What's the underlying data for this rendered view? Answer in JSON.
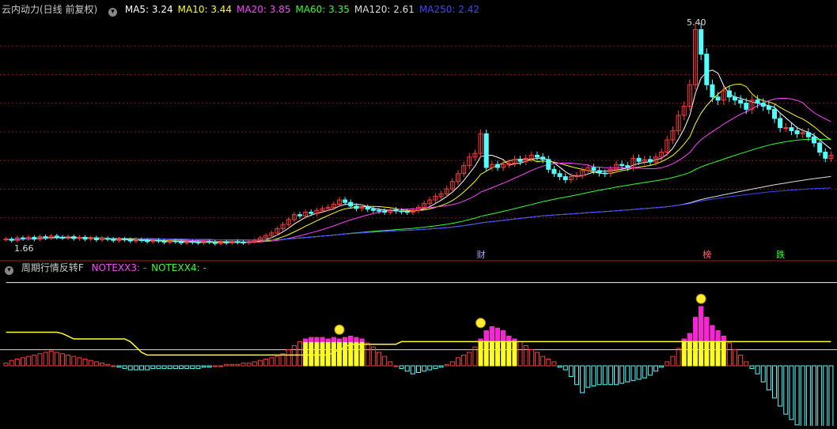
{
  "main_panel": {
    "title": "云内动力(日线 前复权)",
    "ma_labels": [
      {
        "text": "MA5: 3.24",
        "color": "#ffffff"
      },
      {
        "text": "MA10: 3.44",
        "color": "#ffff00"
      },
      {
        "text": "MA20: 3.85",
        "color": "#ff44ff"
      },
      {
        "text": "MA60: 3.35",
        "color": "#33ff33"
      },
      {
        "text": "MA120: 2.61",
        "color": "#dddddd"
      },
      {
        "text": "MA250: 2.42",
        "color": "#4444ff"
      }
    ],
    "high_label": "5.40",
    "low_label": "1.66",
    "markers": [
      {
        "text": "财",
        "color": "#aaaaff",
        "bar": 84
      },
      {
        "text": "榜",
        "color": "#ff6666",
        "bar": 124
      },
      {
        "text": "跌",
        "color": "#33ff33",
        "bar": 137
      }
    ]
  },
  "indicator_panel": {
    "title": "周期行情反转F",
    "notes": [
      {
        "text": "NOTEXX3: -",
        "color": "#ff44ff"
      },
      {
        "text": "NOTEXX4: -",
        "color": "#33ff33"
      }
    ]
  },
  "chart_data": {
    "type": "candlestick",
    "price_range": [
      1.66,
      5.4
    ],
    "closes": [
      1.78,
      1.76,
      1.8,
      1.79,
      1.81,
      1.78,
      1.82,
      1.8,
      1.83,
      1.81,
      1.8,
      1.82,
      1.79,
      1.81,
      1.78,
      1.8,
      1.77,
      1.79,
      1.78,
      1.76,
      1.78,
      1.77,
      1.75,
      1.77,
      1.76,
      1.74,
      1.76,
      1.75,
      1.73,
      1.75,
      1.74,
      1.72,
      1.74,
      1.73,
      1.72,
      1.74,
      1.73,
      1.71,
      1.73,
      1.72,
      1.74,
      1.73,
      1.72,
      1.74,
      1.76,
      1.8,
      1.84,
      1.88,
      1.95,
      2.02,
      2.1,
      2.18,
      2.16,
      2.22,
      2.2,
      2.25,
      2.28,
      2.3,
      2.35,
      2.42,
      2.38,
      2.32,
      2.28,
      2.3,
      2.27,
      2.25,
      2.24,
      2.22,
      2.26,
      2.24,
      2.23,
      2.22,
      2.25,
      2.3,
      2.36,
      2.42,
      2.48,
      2.52,
      2.6,
      2.72,
      2.85,
      2.98,
      3.12,
      3.18,
      3.5,
      2.95,
      3.0,
      2.95,
      3.0,
      3.02,
      3.08,
      3.05,
      3.1,
      3.15,
      3.12,
      3.08,
      2.92,
      2.85,
      2.8,
      2.75,
      2.8,
      2.82,
      2.9,
      2.95,
      2.9,
      2.86,
      2.85,
      2.92,
      3.0,
      2.98,
      2.95,
      3.1,
      3.05,
      3.08,
      3.04,
      3.12,
      3.2,
      3.4,
      3.55,
      3.8,
      3.95,
      4.3,
      5.2,
      4.8,
      4.3,
      4.1,
      4.05,
      4.2,
      4.1,
      4.05,
      4.0,
      3.9,
      4.05,
      4.0,
      3.95,
      3.9,
      3.75,
      3.6,
      3.6,
      3.55,
      3.5,
      3.52,
      3.45,
      3.35,
      3.2,
      3.1,
      3.15
    ],
    "indicator_range": [
      -1.0,
      1.0
    ],
    "indicator_bars": [
      0.02,
      0.04,
      0.05,
      0.06,
      0.07,
      0.08,
      0.09,
      0.1,
      0.11,
      0.1,
      0.09,
      0.08,
      0.07,
      0.06,
      0.05,
      0.04,
      0.03,
      0.02,
      0.01,
      0.0,
      -0.01,
      -0.02,
      -0.03,
      -0.03,
      -0.03,
      -0.03,
      -0.02,
      -0.02,
      -0.02,
      -0.02,
      -0.02,
      -0.02,
      -0.02,
      -0.02,
      -0.02,
      -0.01,
      -0.01,
      0.0,
      0.0,
      0.01,
      0.01,
      0.01,
      0.02,
      0.02,
      0.03,
      0.04,
      0.05,
      0.06,
      0.07,
      0.09,
      0.12,
      0.15,
      0.18,
      0.2,
      0.21,
      0.21,
      0.21,
      0.2,
      0.21,
      0.2,
      0.21,
      0.22,
      0.21,
      0.2,
      0.17,
      0.14,
      0.1,
      0.07,
      0.03,
      0.0,
      -0.02,
      -0.04,
      -0.06,
      -0.05,
      -0.04,
      -0.03,
      -0.02,
      -0.01,
      0.01,
      0.03,
      0.06,
      0.08,
      0.1,
      0.14,
      0.2,
      0.26,
      0.29,
      0.28,
      0.26,
      0.22,
      0.2,
      0.18,
      0.15,
      0.12,
      0.1,
      0.07,
      0.05,
      0.03,
      -0.01,
      -0.03,
      -0.08,
      -0.14,
      -0.2,
      -0.16,
      -0.15,
      -0.14,
      -0.14,
      -0.14,
      -0.14,
      -0.13,
      -0.12,
      -0.11,
      -0.1,
      -0.09,
      -0.07,
      -0.04,
      -0.01,
      0.03,
      0.07,
      0.13,
      0.2,
      0.24,
      0.36,
      0.44,
      0.36,
      0.3,
      0.26,
      0.22,
      0.17,
      0.12,
      0.08,
      0.03,
      -0.02,
      -0.06,
      -0.12,
      -0.18,
      -0.24,
      -0.3,
      -0.36,
      -0.4,
      -0.44,
      -0.48,
      -0.52,
      -0.55,
      -0.58,
      -0.6,
      -0.62
    ],
    "yellow_line": [
      0.25,
      0.25,
      0.25,
      0.25,
      0.25,
      0.25,
      0.25,
      0.25,
      0.25,
      0.25,
      0.24,
      0.22,
      0.2,
      0.2,
      0.2,
      0.2,
      0.2,
      0.2,
      0.2,
      0.2,
      0.2,
      0.2,
      0.18,
      0.14,
      0.1,
      0.08,
      0.08,
      0.08,
      0.08,
      0.08,
      0.08,
      0.08,
      0.08,
      0.08,
      0.08,
      0.08,
      0.08,
      0.08,
      0.08,
      0.08,
      0.08,
      0.08,
      0.08,
      0.08,
      0.08,
      0.08,
      0.08,
      0.08,
      0.08,
      0.08,
      0.08,
      0.08,
      0.08,
      0.08,
      0.08,
      0.08,
      0.08,
      0.08,
      0.1,
      0.12,
      0.14,
      0.16,
      0.16,
      0.16,
      0.16,
      0.16,
      0.16,
      0.16,
      0.16,
      0.16,
      0.18,
      0.18,
      0.18,
      0.18,
      0.18,
      0.18,
      0.18,
      0.18,
      0.18,
      0.18,
      0.18,
      0.18,
      0.18,
      0.18,
      0.18,
      0.18,
      0.18,
      0.18,
      0.18,
      0.18,
      0.18,
      0.18,
      0.18,
      0.18,
      0.18,
      0.18,
      0.18,
      0.18,
      0.18,
      0.18,
      0.18,
      0.18,
      0.18,
      0.18,
      0.18,
      0.18,
      0.18,
      0.18,
      0.18,
      0.18,
      0.18,
      0.18,
      0.18,
      0.18,
      0.18,
      0.18,
      0.18,
      0.18,
      0.18,
      0.18,
      0.18,
      0.18,
      0.18,
      0.18,
      0.18,
      0.18,
      0.18,
      0.18,
      0.18,
      0.18,
      0.18,
      0.18,
      0.18,
      0.18,
      0.18,
      0.18,
      0.18,
      0.18,
      0.18,
      0.18,
      0.18,
      0.18,
      0.18,
      0.18,
      0.18,
      0.18,
      0.18
    ],
    "white_line": [
      0.12,
      0.12,
      0.12,
      0.12,
      0.12,
      0.12,
      0.12,
      0.12,
      0.12,
      0.12,
      0.12,
      0.12,
      0.12,
      0.12,
      0.12,
      0.12,
      0.12,
      0.12,
      0.12,
      0.12,
      0.12,
      0.12,
      0.12,
      0.12,
      0.12,
      0.12,
      0.12,
      0.12,
      0.12,
      0.12,
      0.12,
      0.12,
      0.12,
      0.12,
      0.12,
      0.12,
      0.12,
      0.12,
      0.12,
      0.12,
      0.12,
      0.12,
      0.12,
      0.12,
      0.12,
      0.12,
      0.12,
      0.12,
      0.12,
      0.12,
      0.12,
      0.12,
      0.12,
      0.12,
      0.12,
      0.12,
      0.12,
      0.12,
      0.12,
      0.12,
      0.12,
      0.12,
      0.12,
      0.12,
      0.12,
      0.12,
      0.12,
      0.12,
      0.12,
      0.12,
      0.12,
      0.12,
      0.12,
      0.12,
      0.12,
      0.12,
      0.12,
      0.12,
      0.12,
      0.12,
      0.12,
      0.12,
      0.12,
      0.12,
      0.12,
      0.12,
      0.12,
      0.12,
      0.12,
      0.12,
      0.12,
      0.12,
      0.12,
      0.12,
      0.12,
      0.12,
      0.12,
      0.12,
      0.12,
      0.12,
      0.12,
      0.12,
      0.12,
      0.12,
      0.12,
      0.12,
      0.12,
      0.12,
      0.12,
      0.12,
      0.12,
      0.12,
      0.12,
      0.12,
      0.12,
      0.12,
      0.12,
      0.12,
      0.12,
      0.12,
      0.12,
      0.12,
      0.12,
      0.12,
      0.12,
      0.12,
      0.12,
      0.12,
      0.12,
      0.12,
      0.12,
      0.12,
      0.12,
      0.12,
      0.12,
      0.12,
      0.12,
      0.12,
      0.12,
      0.12,
      0.12,
      0.12,
      0.12,
      0.12,
      0.12,
      0.12,
      0.12,
      0.12,
      0.12
    ],
    "top_line": [
      0.62,
      0.62,
      0.62,
      0.62,
      0.62,
      0.62,
      0.62,
      0.62,
      0.62,
      0.62,
      0.62,
      0.62,
      0.62,
      0.62,
      0.62,
      0.62,
      0.62,
      0.62,
      0.62,
      0.62,
      0.62,
      0.62,
      0.62,
      0.62,
      0.62,
      0.62,
      0.62,
      0.62,
      0.62,
      0.62,
      0.62,
      0.62,
      0.62,
      0.62,
      0.62,
      0.62,
      0.62,
      0.62,
      0.62,
      0.62,
      0.62,
      0.62,
      0.62,
      0.62,
      0.62,
      0.62,
      0.62,
      0.62,
      0.62,
      0.62,
      0.62,
      0.62,
      0.62,
      0.62,
      0.62,
      0.62,
      0.62,
      0.62,
      0.62,
      0.62,
      0.62,
      0.62,
      0.62,
      0.62,
      0.62,
      0.62,
      0.62,
      0.62,
      0.62,
      0.62,
      0.62,
      0.62,
      0.62,
      0.62,
      0.62,
      0.62,
      0.62,
      0.62,
      0.62,
      0.62,
      0.62,
      0.62,
      0.62,
      0.62,
      0.62,
      0.62,
      0.62,
      0.62,
      0.62,
      0.62,
      0.62,
      0.62,
      0.62,
      0.62,
      0.62,
      0.62,
      0.62,
      0.62,
      0.62,
      0.62,
      0.62,
      0.62,
      0.62,
      0.62,
      0.62,
      0.62,
      0.62,
      0.62,
      0.62,
      0.62,
      0.62,
      0.62,
      0.62,
      0.62,
      0.62,
      0.62,
      0.62,
      0.62,
      0.62,
      0.62,
      0.62,
      0.62,
      0.62,
      0.62,
      0.62,
      0.62,
      0.62,
      0.62,
      0.62,
      0.62,
      0.62,
      0.62,
      0.62,
      0.62,
      0.62,
      0.62,
      0.62,
      0.62,
      0.62,
      0.62,
      0.62,
      0.62,
      0.62,
      0.62,
      0.62,
      0.62,
      0.62,
      0.62,
      0.62,
      0.62,
      0.62
    ]
  }
}
